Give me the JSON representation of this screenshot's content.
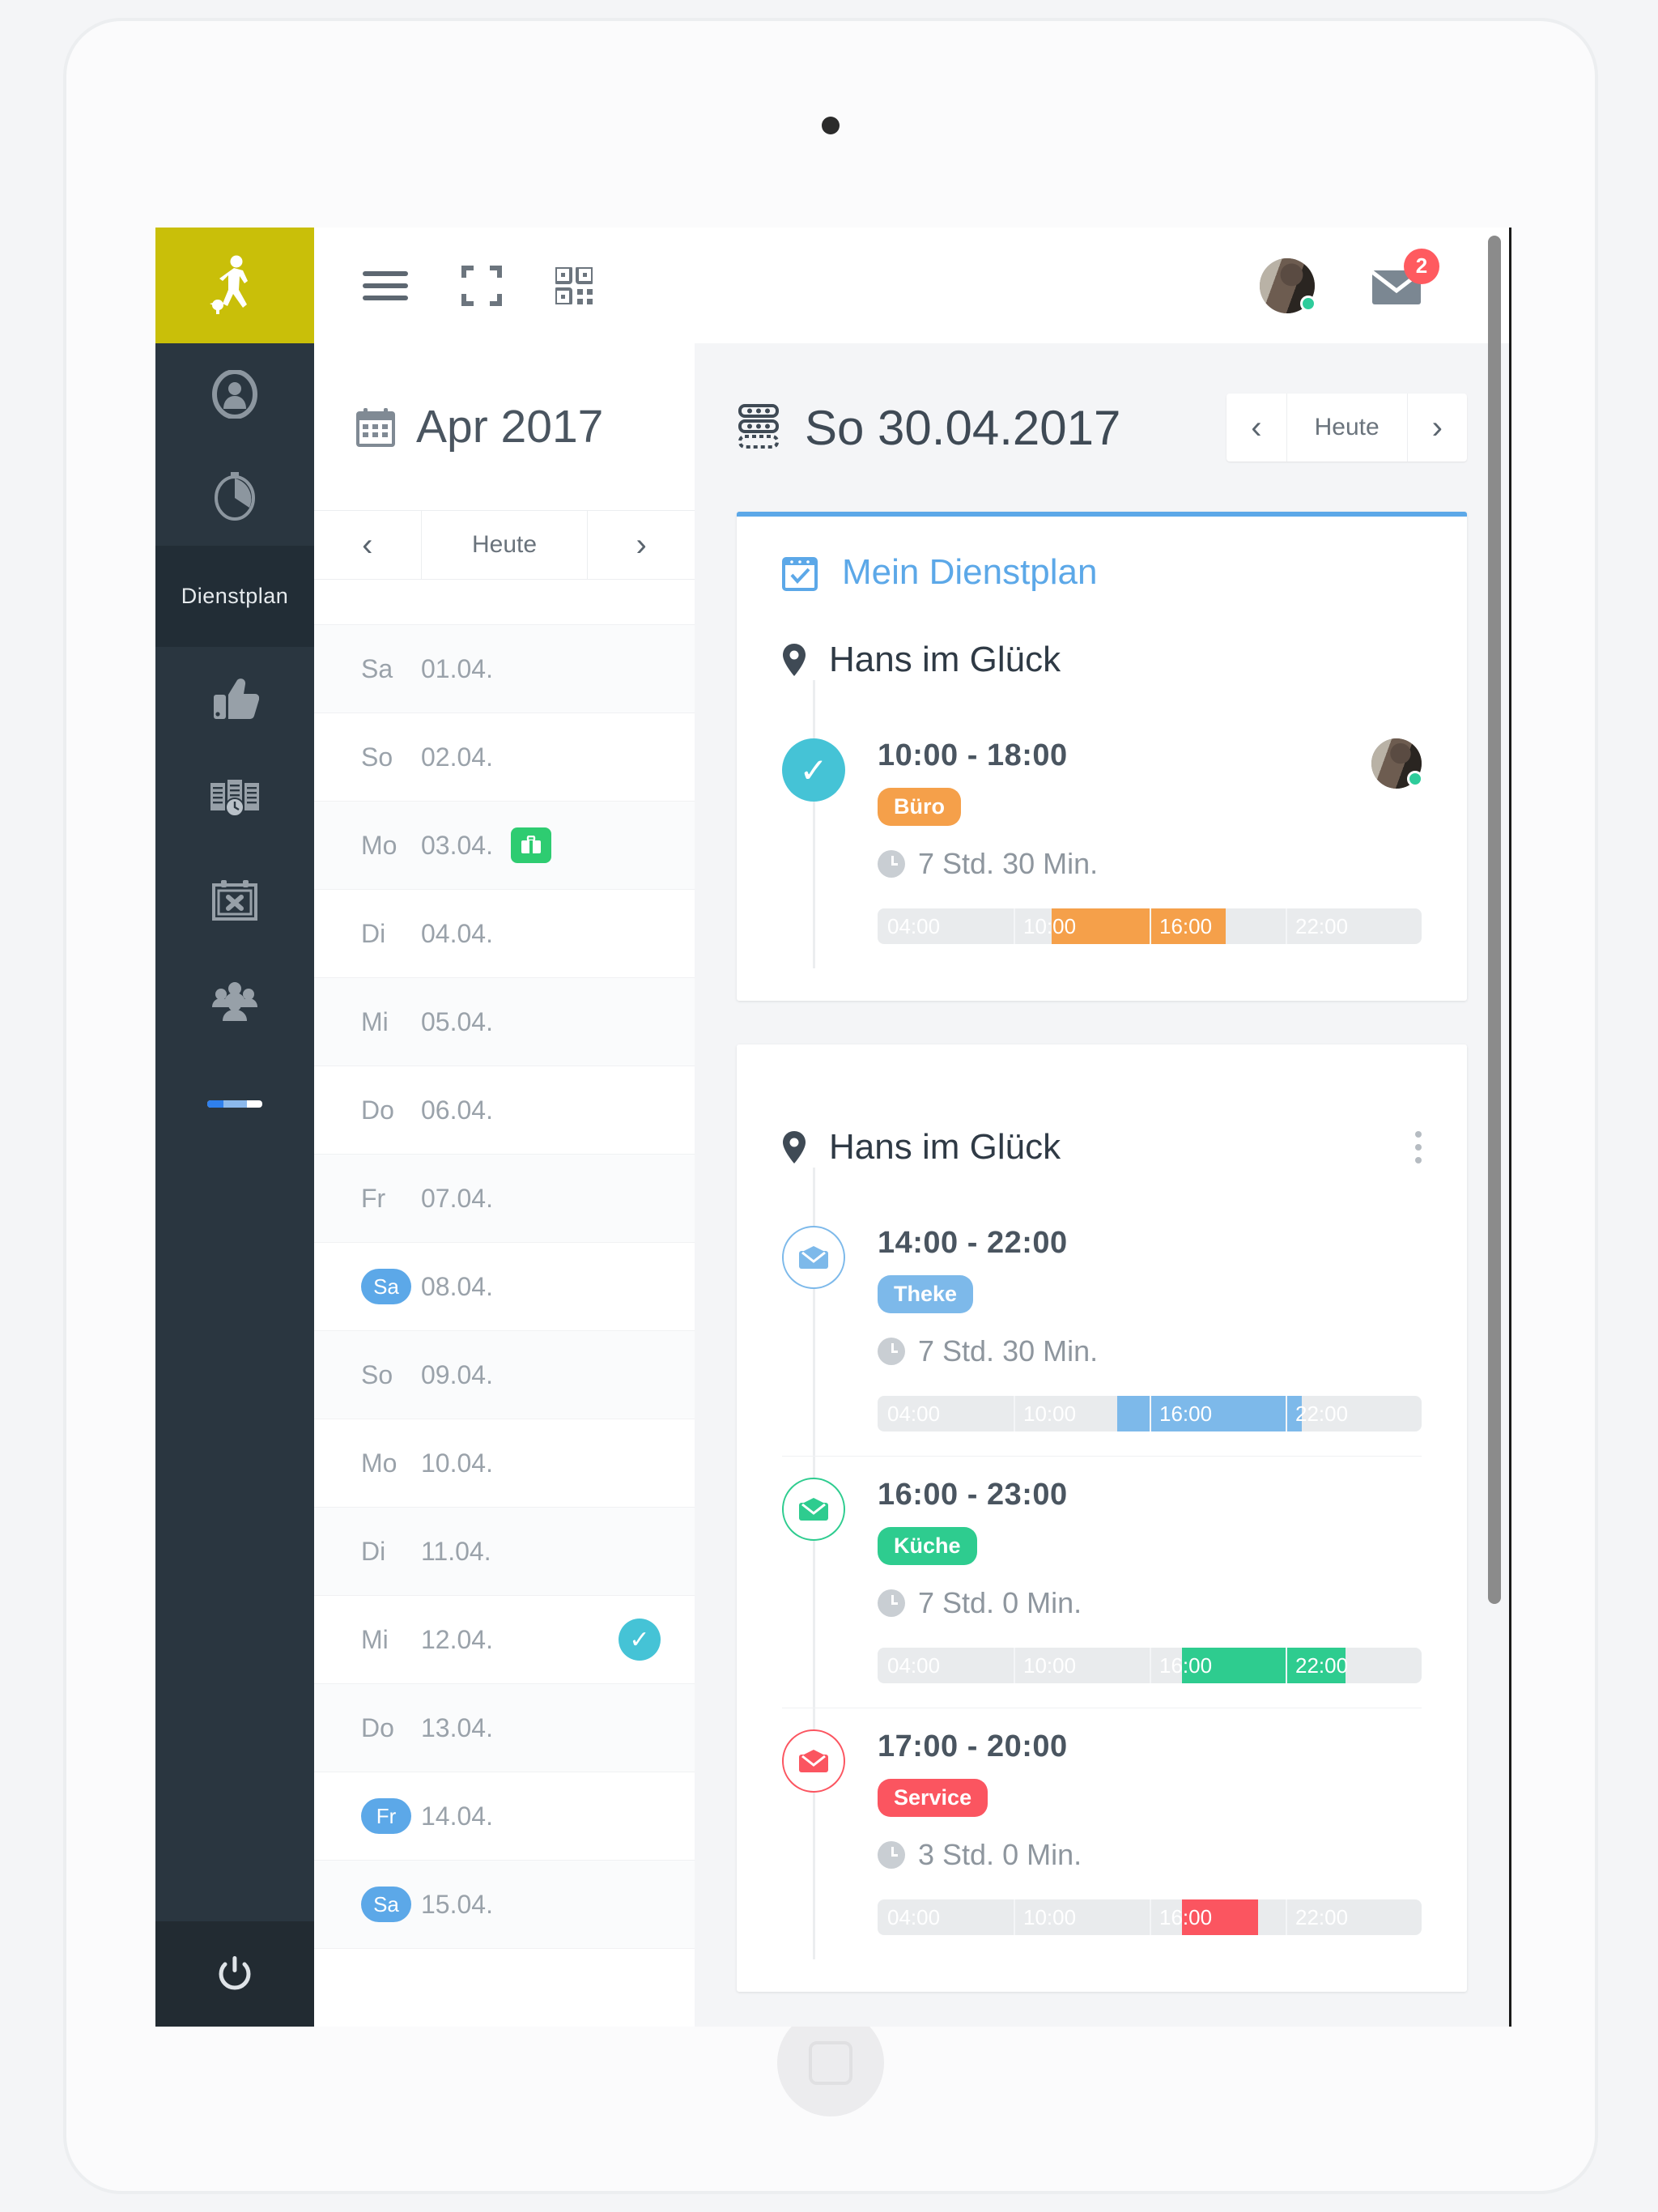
{
  "app": {
    "logo_icon": "walking-person-with-goose-icon",
    "brand_color": "#c9bf09",
    "rail_bg": "#2a3640"
  },
  "topbar": {
    "menu_icon": "hamburger-menu-icon",
    "fullscreen_icon": "fullscreen-icon",
    "qr_icon": "qr-code-icon",
    "avatar_icon": "user-avatar",
    "mail_icon": "mail-icon",
    "mail_badge": "2",
    "badge_color": "#ff5a5f"
  },
  "sidebar": {
    "items": [
      {
        "icon": "user-circle-icon",
        "label": ""
      },
      {
        "icon": "stopwatch-icon",
        "label": ""
      },
      {
        "icon": "dienstplan-label",
        "label": "Dienstplan"
      },
      {
        "icon": "thumbs-up-icon",
        "label": ""
      },
      {
        "icon": "open-book-clock-icon",
        "label": ""
      },
      {
        "icon": "calendar-x-icon",
        "label": ""
      },
      {
        "icon": "people-group-icon",
        "label": ""
      }
    ],
    "progress_fill": "#2f80ed",
    "progress_track_mid": "#8cb9ec",
    "power_icon": "power-icon"
  },
  "month_panel": {
    "calendar_icon": "calendar-icon",
    "title": "Apr 2017",
    "nav": {
      "prev": "‹",
      "today": "Heute",
      "next": "›"
    },
    "days": [
      {
        "weekday": "Sa",
        "date": "01.04.",
        "pill": false,
        "badge": "none"
      },
      {
        "weekday": "So",
        "date": "02.04.",
        "pill": false,
        "badge": "none"
      },
      {
        "weekday": "Mo",
        "date": "03.04.",
        "pill": false,
        "badge": "briefcase"
      },
      {
        "weekday": "Di",
        "date": "04.04.",
        "pill": false,
        "badge": "none"
      },
      {
        "weekday": "Mi",
        "date": "05.04.",
        "pill": false,
        "badge": "none"
      },
      {
        "weekday": "Do",
        "date": "06.04.",
        "pill": false,
        "badge": "none"
      },
      {
        "weekday": "Fr",
        "date": "07.04.",
        "pill": false,
        "badge": "none"
      },
      {
        "weekday": "Sa",
        "date": "08.04.",
        "pill": true,
        "badge": "none"
      },
      {
        "weekday": "So",
        "date": "09.04.",
        "pill": false,
        "badge": "none"
      },
      {
        "weekday": "Mo",
        "date": "10.04.",
        "pill": false,
        "badge": "none"
      },
      {
        "weekday": "Di",
        "date": "11.04.",
        "pill": false,
        "badge": "none"
      },
      {
        "weekday": "Mi",
        "date": "12.04.",
        "pill": false,
        "badge": "check"
      },
      {
        "weekday": "Do",
        "date": "13.04.",
        "pill": false,
        "badge": "none"
      },
      {
        "weekday": "Fr",
        "date": "14.04.",
        "pill": true,
        "badge": "none"
      },
      {
        "weekday": "Sa",
        "date": "15.04.",
        "pill": true,
        "badge": "none"
      }
    ]
  },
  "day_panel": {
    "header_icon": "roster-icon",
    "title": "So 30.04.2017",
    "nav": {
      "prev": "‹",
      "today": "Heute",
      "next": "›"
    },
    "cards": [
      {
        "accent": "#5ca8e8",
        "plan_title": "Mein Dienstplan",
        "plan_icon": "calendar-check-icon",
        "location": "Hans im Glück",
        "location_icon": "map-pin-icon",
        "kebab": false,
        "shifts": [
          {
            "bullet": "check",
            "bullet_style": "solid",
            "color": "#45c3d6",
            "time": "10:00 - 18:00",
            "tag": "Büro",
            "tag_color": "#f5a04a",
            "duration": "7 Std. 30 Min.",
            "avatar": true,
            "bar_color": "#f5a04a",
            "bar_start_pct": 32,
            "bar_end_pct": 64,
            "ticks": [
              "04:00",
              "10:00",
              "16:00",
              "22:00"
            ]
          }
        ]
      },
      {
        "accent": "",
        "plan_title": "",
        "plan_icon": "",
        "location": "Hans im Glück",
        "location_icon": "map-pin-icon",
        "kebab": true,
        "shifts": [
          {
            "bullet": "envelope",
            "bullet_style": "ring",
            "color": "#7db9ea",
            "time": "14:00 - 22:00",
            "tag": "Theke",
            "tag_color": "#7db9ea",
            "duration": "7 Std. 30 Min.",
            "avatar": false,
            "bar_color": "#7db9ea",
            "bar_start_pct": 44,
            "bar_end_pct": 78,
            "ticks": [
              "04:00",
              "10:00",
              "16:00",
              "22:00"
            ]
          },
          {
            "bullet": "envelope",
            "bullet_style": "ring",
            "color": "#2ecc8f",
            "time": "16:00 - 23:00",
            "tag": "Küche",
            "tag_color": "#2ecc8f",
            "duration": "7 Std. 0 Min.",
            "avatar": false,
            "bar_color": "#2ecc8f",
            "bar_start_pct": 56,
            "bar_end_pct": 86,
            "ticks": [
              "04:00",
              "10:00",
              "16:00",
              "22:00"
            ]
          },
          {
            "bullet": "envelope",
            "bullet_style": "ring",
            "color": "#fb5560",
            "time": "17:00 - 20:00",
            "tag": "Service",
            "tag_color": "#fb5560",
            "duration": "3 Std. 0 Min.",
            "avatar": false,
            "bar_color": "#fb5560",
            "bar_start_pct": 56,
            "bar_end_pct": 70,
            "ticks": [
              "04:00",
              "10:00",
              "16:00",
              "22:00"
            ]
          }
        ]
      }
    ]
  }
}
